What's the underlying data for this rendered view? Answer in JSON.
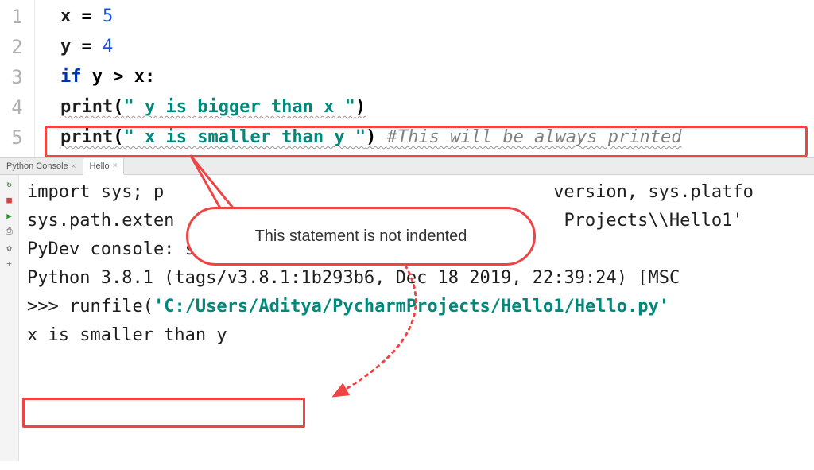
{
  "editor": {
    "line_numbers": [
      "1",
      "2",
      "3",
      "4",
      "5"
    ],
    "lines": {
      "l1_var": "x",
      "l1_eq": " = ",
      "l1_val": "5",
      "l2_var": "y",
      "l2_eq": " = ",
      "l2_val": "4",
      "l3_if": "if",
      "l3_cond": " y > x:",
      "l4_indent": "    ",
      "l4_fn": "print",
      "l4_paren_open": "(",
      "l4_str": "\" y is bigger than x \"",
      "l4_paren_close": ")",
      "l5_fn": "print",
      "l5_paren_open": "(",
      "l5_str": "\" x is smaller than y \"",
      "l5_paren_close": ")  ",
      "l5_cmt": "#This will be always printed"
    }
  },
  "tabs": {
    "tab1": "Python Console",
    "tab2": "Hello"
  },
  "toolbar_icons": {
    "rerun": "↻",
    "stop": "■",
    "play": "▶",
    "print": "⎙",
    "gear": "✿",
    "plus": "+"
  },
  "console": {
    "l1a": "import sys; p",
    "l1b": "version, sys.platfo",
    "l2a": "sys.path.exten",
    "l2b": "Projects\\\\Hello1'",
    "l3": "",
    "l4": "PyDev console: starting.",
    "l5": "",
    "l6": "Python 3.8.1 (tags/v3.8.1:1b293b6, Dec 18 2019, 22:39:24) [MSC",
    "l7prompt": ">>> ",
    "l7fn": "runfile(",
    "l7str": "'C:/Users/Aditya/PycharmProjects/Hello1/Hello.py'",
    "l8": " x is smaller than y "
  },
  "callout": {
    "text": "This statement is not indented"
  }
}
